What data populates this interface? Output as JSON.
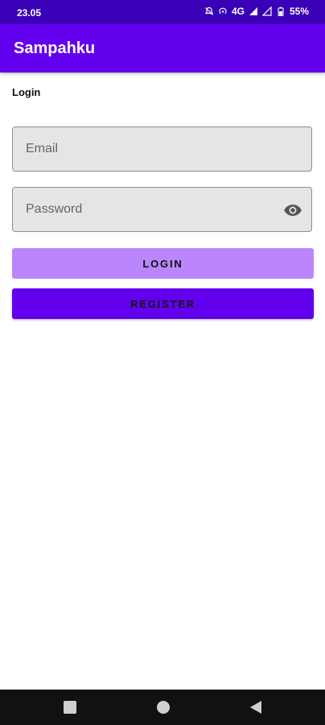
{
  "status_bar": {
    "time": "23.05",
    "network": "4G",
    "battery": "55%",
    "icons": [
      "mute-icon",
      "hotspot-icon",
      "signal-icon",
      "signal-icon-2",
      "battery-icon"
    ]
  },
  "app_bar": {
    "title": "Sampahku"
  },
  "screen": {
    "label": "Login"
  },
  "form": {
    "email": {
      "placeholder": "Email",
      "value": ""
    },
    "password": {
      "placeholder": "Password",
      "value": "",
      "toggle_icon": "eye-icon"
    }
  },
  "buttons": {
    "login_label": "LOGIN",
    "register_label": "REGISTER"
  },
  "nav": {
    "icons": [
      "recent-apps-icon",
      "home-icon",
      "back-icon"
    ]
  },
  "colors": {
    "primary": "#6200ee",
    "primary_dark": "#3a00b8",
    "login_button": "#bb86fc",
    "field_background": "#e5e5e5"
  }
}
